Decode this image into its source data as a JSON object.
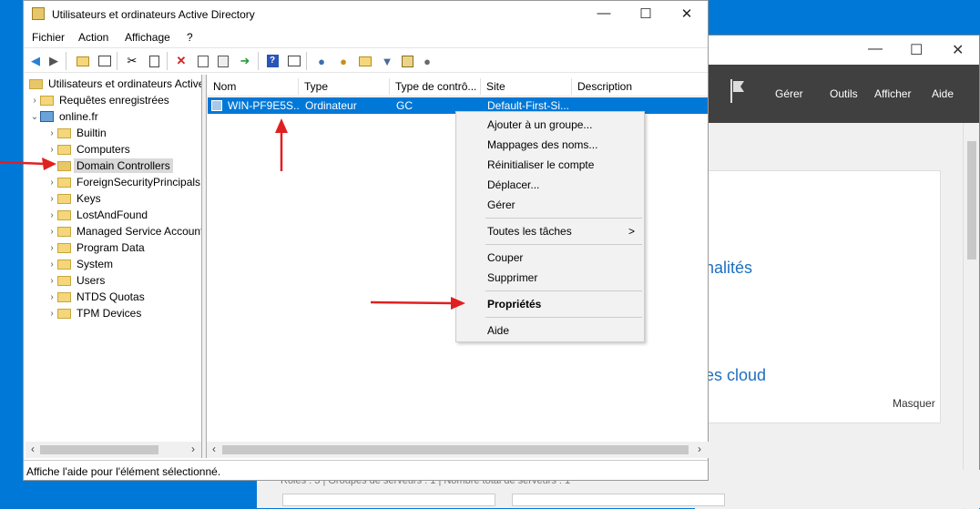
{
  "aduc": {
    "title": "Utilisateurs et ordinateurs Active Directory",
    "menu": [
      "Fichier",
      "Action",
      "Affichage",
      "?"
    ],
    "tree": {
      "root": "Utilisateurs et ordinateurs Active",
      "saved_queries": "Requêtes enregistrées",
      "domain": "online.fr",
      "children": [
        "Builtin",
        "Computers",
        "Domain Controllers",
        "ForeignSecurityPrincipals",
        "Keys",
        "LostAndFound",
        "Managed Service Accounts",
        "Program Data",
        "System",
        "Users",
        "NTDS Quotas",
        "TPM Devices"
      ],
      "selected": "Domain Controllers"
    },
    "list": {
      "columns": [
        "Nom",
        "Type",
        "Type de contrô...",
        "Site",
        "Description"
      ],
      "rows": [
        {
          "nom": "WIN-PF9E5S...",
          "type": "Ordinateur",
          "type_controleur": "GC",
          "site": "Default-First-Si...",
          "description": ""
        }
      ]
    },
    "status": "Affiche l'aide pour l'élément sélectionné."
  },
  "context_menu": {
    "items": [
      "Ajouter à un groupe...",
      "Mappages des noms...",
      "Réinitialiser le compte",
      "Déplacer...",
      "Gérer",
      "Toutes les tâches",
      "Couper",
      "Supprimer",
      "Propriétés",
      "Aide"
    ],
    "submenu_arrow": ">",
    "bold_item": "Propriétés"
  },
  "server_manager": {
    "menu": [
      "Gérer",
      "Outils",
      "Afficher",
      "Aide"
    ],
    "tile_text_1": "nalités",
    "tile_text_2": "es cloud",
    "hide_link": "Masquer",
    "bottom_text": "Rôles : 3   |   Groupes de serveurs : 1   |   Nombre total de serveurs : 1"
  },
  "window_controls": {
    "minimize": "—",
    "maximize": "☐",
    "close": "✕"
  },
  "colors": {
    "selection": "#0078d7",
    "desktop": "#0078d7",
    "annotation_arrow": "#e02020",
    "sm_topbar": "#404040",
    "sm_link": "#1e6fbf"
  },
  "icons": [
    "back-arrow-icon",
    "forward-arrow-icon",
    "up-folder-icon",
    "view-icon",
    "cut-icon",
    "copy-icon",
    "delete-icon",
    "properties-icon",
    "refresh-icon",
    "export-icon",
    "help-icon",
    "console-icon",
    "user-icon",
    "users-icon",
    "group-icon",
    "filter-icon",
    "find-icon",
    "delegate-icon"
  ]
}
